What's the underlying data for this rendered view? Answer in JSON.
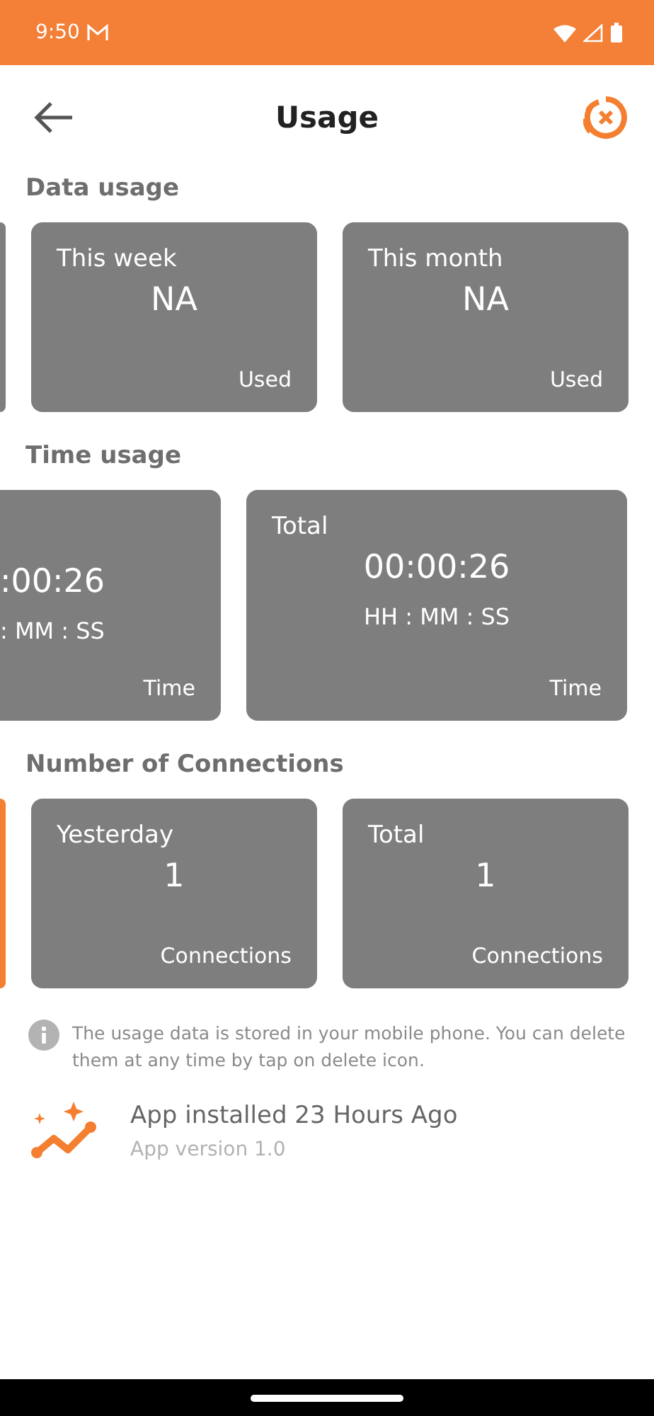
{
  "status_bar": {
    "time": "9:50"
  },
  "header": {
    "title": "Usage"
  },
  "sections": [
    {
      "title": "Data usage",
      "cards": [
        {
          "kind": "edge",
          "selected": false
        },
        {
          "kind": "card",
          "label": "This week",
          "value": "NA",
          "footer": "Used",
          "selected": false
        },
        {
          "kind": "card",
          "label": "This month",
          "value": "NA",
          "footer": "Used",
          "selected": false
        }
      ]
    },
    {
      "title": "Time usage",
      "cards": [
        {
          "kind": "partial",
          "value": ":00:26",
          "unit": ": MM : SS",
          "footer": "Time",
          "selected": false
        },
        {
          "kind": "wide",
          "label": "Total",
          "value": "00:00:26",
          "unit": "HH : MM : SS",
          "footer": "Time",
          "selected": false
        }
      ]
    },
    {
      "title": "Number of Connections",
      "cards": [
        {
          "kind": "edge",
          "selected": true
        },
        {
          "kind": "card",
          "label": "Yesterday",
          "value": "1",
          "footer": "Connections",
          "selected": false
        },
        {
          "kind": "card",
          "label": "Total",
          "value": "1",
          "footer": "Connections",
          "selected": false
        }
      ]
    }
  ],
  "note": "The usage data is stored in your mobile phone. You can delete them at any time by tap on delete icon.",
  "install": {
    "title": "App installed 23 Hours Ago",
    "version": "App version 1.0"
  }
}
